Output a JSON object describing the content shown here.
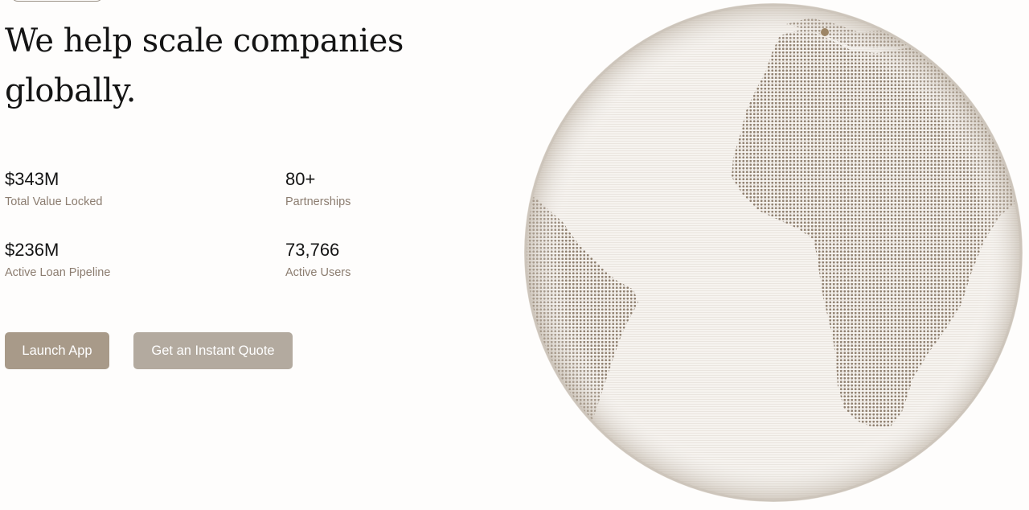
{
  "hero": {
    "headline": "We help scale companies globally."
  },
  "stats": {
    "tvl": {
      "value": "$343M",
      "label": "Total Value Locked"
    },
    "partnerships": {
      "value": "80+",
      "label": "Partnerships"
    },
    "pipeline": {
      "value": "$236M",
      "label": "Active Loan Pipeline"
    },
    "users": {
      "value": "73,766",
      "label": "Active Users"
    }
  },
  "actions": {
    "launch_label": "Launch App",
    "quote_label": "Get an Instant Quote"
  },
  "colors": {
    "accent": "#a89a89",
    "secondary_button": "#b3aa9f",
    "label_text": "#8c7d70",
    "land": "#8f8070",
    "globe_base": "#f6f3ef",
    "globe_rim": "#cdc5bb"
  }
}
